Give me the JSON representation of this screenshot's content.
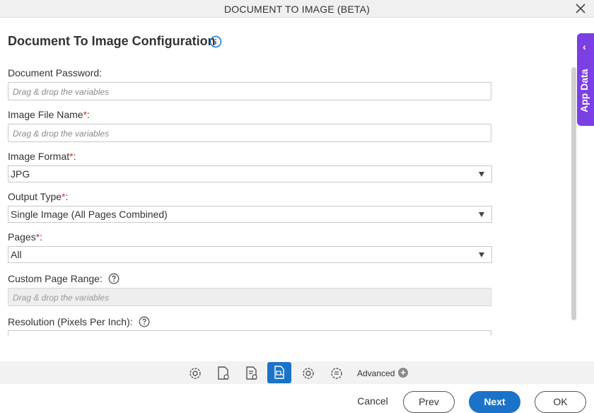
{
  "dialog": {
    "title": "DOCUMENT TO IMAGE (BETA)"
  },
  "form": {
    "heading": "Document To Image Configuration",
    "fields": {
      "document_password": {
        "label": "Document Password:",
        "placeholder": "Drag & drop the variables"
      },
      "image_file_name": {
        "label": "Image File Name",
        "required_mark": "*",
        "colon": ":",
        "placeholder": "Drag & drop the variables"
      },
      "image_format": {
        "label": "Image Format",
        "required_mark": "*",
        "colon": ":",
        "value": "JPG"
      },
      "output_type": {
        "label": "Output Type",
        "required_mark": "*",
        "colon": ":",
        "value": "Single Image (All Pages Combined)"
      },
      "pages": {
        "label": "Pages",
        "required_mark": "*",
        "colon": ":",
        "value": "All"
      },
      "custom_page_range": {
        "label": "Custom Page Range:",
        "placeholder": "Drag & drop the variables"
      },
      "resolution": {
        "label": "Resolution (Pixels Per Inch):"
      }
    }
  },
  "side_panel": {
    "label": "App Data"
  },
  "toolbar": {
    "advanced_label": "Advanced",
    "plus": "+"
  },
  "footer": {
    "cancel": "Cancel",
    "prev": "Prev",
    "next": "Next",
    "ok": "OK"
  },
  "colors": {
    "accent": "#1a73c8",
    "app_data": "#7b3fe4",
    "required": "#c0392b"
  }
}
